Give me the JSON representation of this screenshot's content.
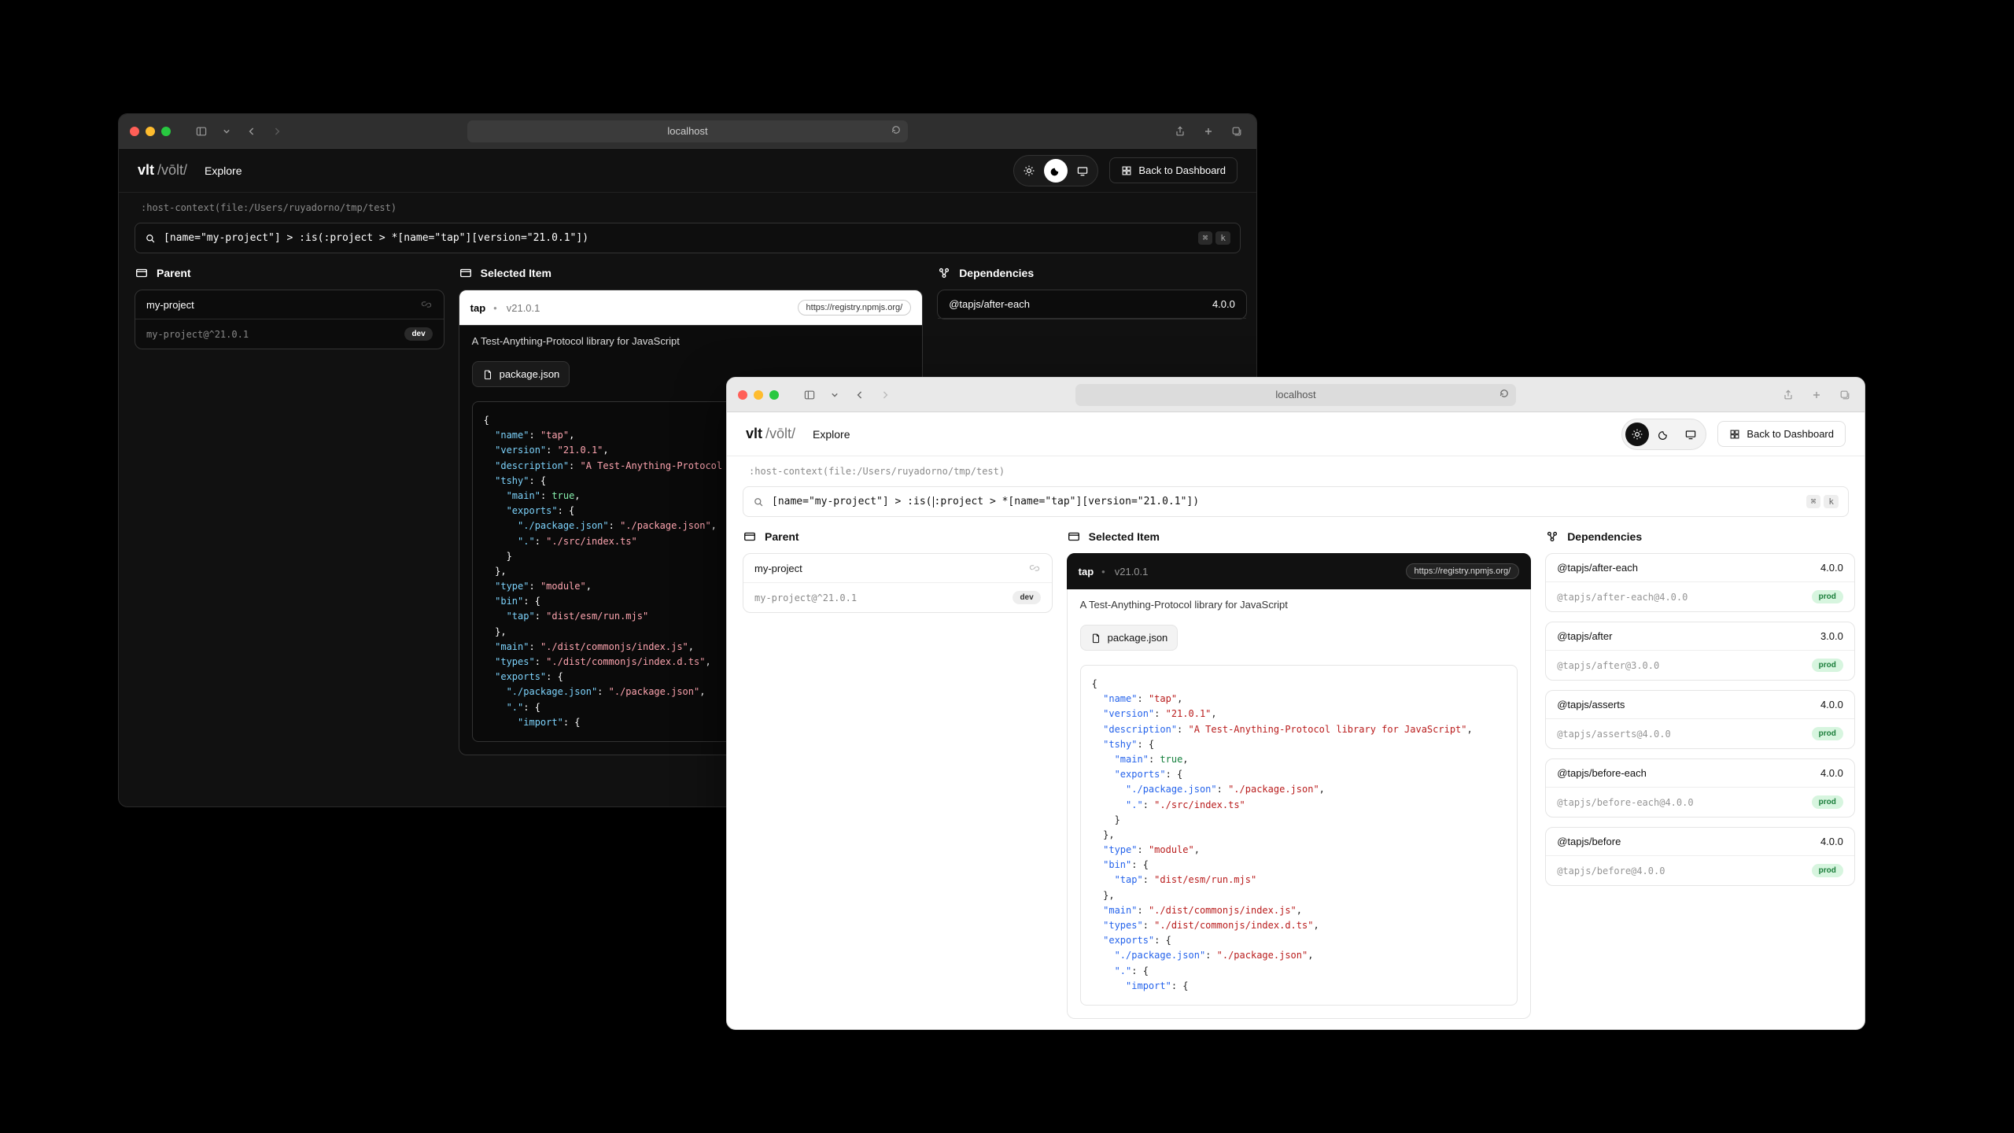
{
  "appBrand": "vlt",
  "appPhonetic": "/vōlt/",
  "nav": {
    "explore": "Explore"
  },
  "backToDashboard": "Back to Dashboard",
  "hostContext": ":host-context(file:/Users/ruyadorno/tmp/test)",
  "queryDark": "[name=\"my-project\"] > :is(:project > *[name=\"tap\"][version=\"21.0.1\"])",
  "queryLight": "[name=\"my-project\"] > :is(:project > *[name=\"tap\"][version=\"21.0.1\"])",
  "kbd": {
    "cmd": "⌘",
    "k": "k"
  },
  "urlbar": "localhost",
  "columns": {
    "parent": "Parent",
    "selected": "Selected Item",
    "dependencies": "Dependencies"
  },
  "parent": {
    "name": "my-project",
    "spec": "my-project@^21.0.1",
    "tag": "dev"
  },
  "selected": {
    "name": "tap",
    "version": "v21.0.1",
    "registry": "https://registry.npmjs.org/",
    "description": "A Test-Anything-Protocol library for JavaScript",
    "packageJsonLabel": "package.json",
    "code": "{\n  \"name\": \"tap\",\n  \"version\": \"21.0.1\",\n  \"description\": \"A Test-Anything-Protocol library for JavaScript\",\n  \"tshy\": {\n    \"main\": true,\n    \"exports\": {\n      \"./package.json\": \"./package.json\",\n      \".\": \"./src/index.ts\"\n    }\n  },\n  \"type\": \"module\",\n  \"bin\": {\n    \"tap\": \"dist/esm/run.mjs\"\n  },\n  \"main\": \"./dist/commonjs/index.js\",\n  \"types\": \"./dist/commonjs/index.d.ts\",\n  \"exports\": {\n    \"./package.json\": \"./package.json\",\n    \".\": {\n      \"import\": {"
  },
  "dependenciesDark": [
    {
      "name": "@tapjs/after-each",
      "version": "4.0.0"
    }
  ],
  "dependenciesLight": [
    {
      "name": "@tapjs/after-each",
      "version": "4.0.0",
      "spec": "@tapjs/after-each@4.0.0",
      "tag": "prod"
    },
    {
      "name": "@tapjs/after",
      "version": "3.0.0",
      "spec": "@tapjs/after@3.0.0",
      "tag": "prod"
    },
    {
      "name": "@tapjs/asserts",
      "version": "4.0.0",
      "spec": "@tapjs/asserts@4.0.0",
      "tag": "prod"
    },
    {
      "name": "@tapjs/before-each",
      "version": "4.0.0",
      "spec": "@tapjs/before-each@4.0.0",
      "tag": "prod"
    },
    {
      "name": "@tapjs/before",
      "version": "4.0.0",
      "spec": "@tapjs/before@4.0.0",
      "tag": "prod"
    }
  ]
}
